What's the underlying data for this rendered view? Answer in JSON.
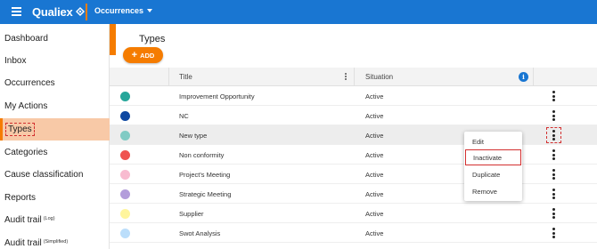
{
  "app": {
    "logo": "Qualiex",
    "module": "Occurrences"
  },
  "colors": {
    "topbar": "#1976d2",
    "accent": "#f57c00",
    "active_nav_bg": "#f8c9a7",
    "highlight_red": "#d32f2f"
  },
  "sidebar": {
    "items": [
      {
        "label": "Dashboard",
        "suffix": ""
      },
      {
        "label": "Inbox",
        "suffix": ""
      },
      {
        "label": "Occurrences",
        "suffix": ""
      },
      {
        "label": "My Actions",
        "suffix": ""
      },
      {
        "label": "Types",
        "suffix": "",
        "active": true
      },
      {
        "label": "Categories",
        "suffix": ""
      },
      {
        "label": "Cause classification",
        "suffix": ""
      },
      {
        "label": "Reports",
        "suffix": ""
      },
      {
        "label": "Audit trail",
        "suffix": "(Log)"
      },
      {
        "label": "Audit trail",
        "suffix": "(Simplified)"
      }
    ]
  },
  "page": {
    "title": "Types",
    "add_label": "ADD",
    "add_icon": "plus-icon"
  },
  "table": {
    "columns": {
      "title": "Title",
      "situation": "Situation",
      "info_icon": "i"
    },
    "rows": [
      {
        "color": "#26a69a",
        "title": "Improvement Opportunity",
        "situation": "Active"
      },
      {
        "color": "#0d47a1",
        "title": "NC",
        "situation": "Active"
      },
      {
        "color": "#80cbc4",
        "title": "New type",
        "situation": "Active"
      },
      {
        "color": "#ef5350",
        "title": "Non conformity",
        "situation": "Active"
      },
      {
        "color": "#f8bbd0",
        "title": "Project's Meeting",
        "situation": "Active"
      },
      {
        "color": "#b39ddb",
        "title": "Strategic Meeting",
        "situation": "Active"
      },
      {
        "color": "#fff59d",
        "title": "Supplier",
        "situation": "Active"
      },
      {
        "color": "#bbdefb",
        "title": "Swot Analysis",
        "situation": "Active"
      }
    ]
  },
  "context_menu": {
    "items": [
      "Edit",
      "Inactivate",
      "Duplicate",
      "Remove"
    ],
    "selected": "Inactivate"
  }
}
